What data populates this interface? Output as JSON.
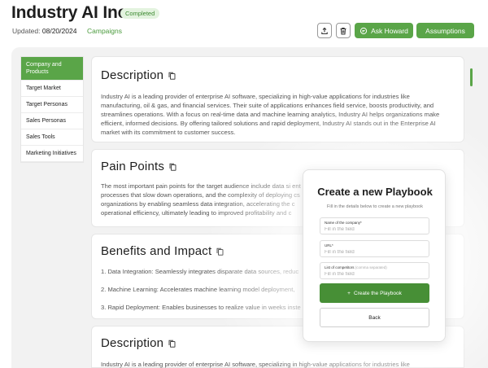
{
  "header": {
    "title": "Industry AI Inc.",
    "status_badge": "Completed",
    "updated_label": "Updated:",
    "updated_date": "08/20/2024",
    "campaigns_link": "Campaigns",
    "ask_label": "Ask Howard",
    "assumptions_label": "Assumptions"
  },
  "sidebar": {
    "items": [
      {
        "label": "Company and Products"
      },
      {
        "label": "Target Market"
      },
      {
        "label": "Target Personas"
      },
      {
        "label": "Sales Personas"
      },
      {
        "label": "Sales Tools"
      },
      {
        "label": "Marketing Initiatives"
      }
    ]
  },
  "sections": [
    {
      "title": "Description",
      "body": "Industry AI is a leading provider of enterprise AI software, specializing in high-value applications for industries like\nmanufacturing, oil & gas, and financial services. Their suite of applications enhances field service, boosts productivity, and\nstreamlines operations. With a focus on real-time data and machine learning analytics, Industry AI helps organizations make\nefficient, informed decisions. By offering tailored solutions and rapid deployment, Industry AI stands out in the Enterprise AI\nmarket with its commitment to customer success."
    },
    {
      "title": "Pain Points",
      "body": "The most important pain points for the target audience include data si                                                                    ent\nprocesses that slow down operations, and the complexity of deploying                                                              cs\norganizations by enabling seamless data integration, accelerating the c\noperational efficiency, ultimately leading to improved profitability and c"
    },
    {
      "title": "Benefits and Impact",
      "body": "1. Data Integration: Seamlessly integrates disparate data sources, reduc\n\n2. Machine Learning: Accelerates machine learning model deployment,\n\n3. Rapid Deployment: Enables businesses to realize value in weeks inste"
    },
    {
      "title": "Description",
      "body": "Industry AI is a leading provider of enterprise AI software, specializing in high-value applications for industries like"
    }
  ],
  "modal": {
    "title": "Create a new Playbook",
    "subtitle": "Fill in the details below to create a new playbook",
    "fields": [
      {
        "label": "Name of the company*",
        "hint": "",
        "placeholder": "Fill in the field"
      },
      {
        "label": "URL*",
        "hint": "",
        "placeholder": "Fill in the field"
      },
      {
        "label": "List of competitors",
        "hint": "(comma separated)",
        "placeholder": "Fill in the field"
      }
    ],
    "create_label": "Create the Playbook",
    "back_label": "Back"
  },
  "colors": {
    "accent": "#5aa548",
    "accent_dark": "#478f36",
    "badge_bg": "#e3f3df"
  }
}
